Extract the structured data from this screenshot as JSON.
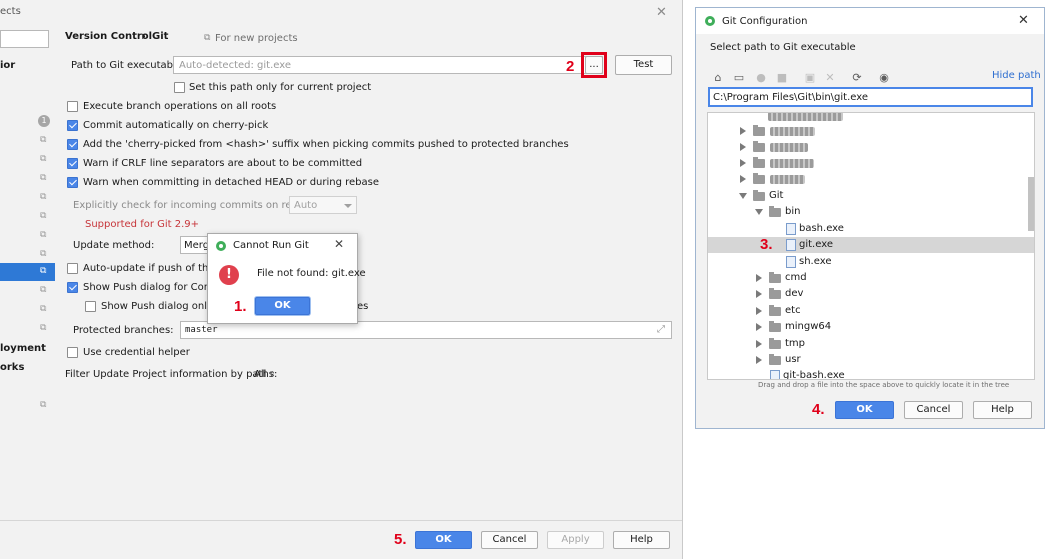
{
  "settings": {
    "sidebar": {
      "title_fragment": "ects",
      "items": [
        "ior",
        "loyment",
        "orks"
      ],
      "badge_count": "1"
    },
    "breadcrumb": {
      "parent": "Version Control",
      "separator": "›",
      "current": "Git",
      "scope_note": "For new projects"
    },
    "git_path": {
      "label": "Path to Git executable:",
      "placeholder": "Auto-detected: git.exe",
      "browse_label": "...",
      "test_label": "Test",
      "current_project_only": "Set this path only for current project"
    },
    "options": {
      "branch_ops_all_roots": "Execute branch operations on all roots",
      "commit_cherry_pick": "Commit automatically on cherry-pick",
      "cherry_picked_suffix": "Add the 'cherry-picked from <hash>' suffix when picking commits pushed to protected branches",
      "crlf_warn": "Warn if CRLF line separators are about to be committed",
      "detached_head_warn": "Warn when committing in detached HEAD or during rebase",
      "incoming_check_label": "Explicitly check for incoming commits on remotes:",
      "incoming_check_value": "Auto",
      "supported_note": "Supported for Git 2.9+",
      "update_method_label": "Update method:",
      "update_method_value": "Merg",
      "auto_update_push": "Auto-update if push of the cu",
      "show_push_dialog": "Show Push dialog for Commit",
      "show_push_only_prefix": "Show Push dialog only wh",
      "show_push_only_suffix": "es",
      "protected_branches_label": "Protected branches:",
      "protected_branches_value": "master",
      "credential_helper": "Use credential helper",
      "filter_update_label": "Filter Update Project information by paths:",
      "filter_update_value": "All"
    },
    "footer": {
      "ok": "OK",
      "cancel": "Cancel",
      "apply": "Apply",
      "help": "Help"
    }
  },
  "error_dialog": {
    "title": "Cannot Run Git",
    "message": "File not found: git.exe",
    "ok": "OK"
  },
  "git_config": {
    "title": "Git Configuration",
    "subtitle": "Select path to Git executable",
    "hide_path": "Hide path",
    "path_value": "C:\\Program Files\\Git\\bin\\git.exe",
    "tree": {
      "git": "Git",
      "bin": "bin",
      "bash": "bash.exe",
      "gitexe": "git.exe",
      "sh": "sh.exe",
      "cmd": "cmd",
      "dev": "dev",
      "etc": "etc",
      "mingw64": "mingw64",
      "tmp": "tmp",
      "usr": "usr",
      "gitbash": "git-bash.exe"
    },
    "hint": "Drag and drop a file into the space above to quickly locate it in the tree",
    "ok": "OK",
    "cancel": "Cancel",
    "help": "Help"
  },
  "steps": {
    "s1": "1.",
    "s2": "2",
    "s3": "3.",
    "s4": "4.",
    "s5": "5."
  },
  "colors": {
    "accent": "#4a86e8",
    "annotation_red": "#e0001a",
    "selection": "#2e79d6",
    "error_icon": "#e0404d"
  }
}
